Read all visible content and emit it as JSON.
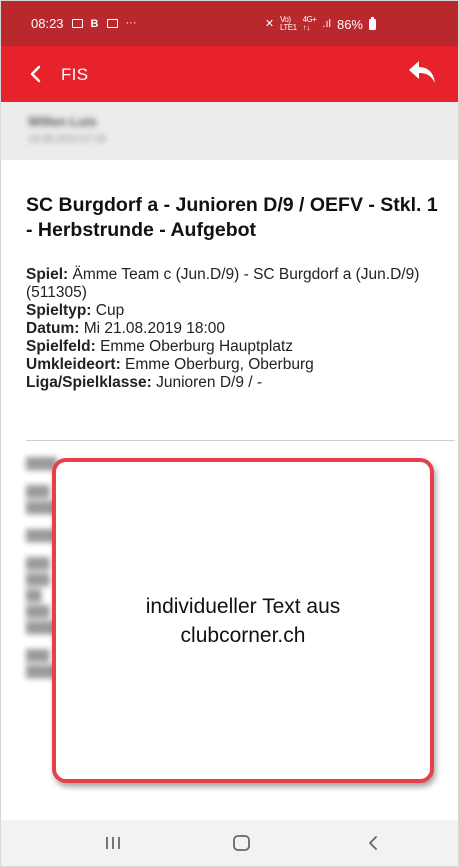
{
  "status_bar": {
    "time": "08:23",
    "notif_b": "B",
    "more": "···",
    "battery_percent": "86%"
  },
  "app_bar": {
    "title": "FIS"
  },
  "sender": {
    "name": "Willen Luis",
    "date": "19.08.2019 07:29"
  },
  "message": {
    "title": "SC Burgdorf a - Junioren D/9 / OEFV - Stkl. 1 - Herbstrunde - Aufgebot",
    "details": [
      {
        "label": "Spiel:",
        "value": " Ämme Team c (Jun.D/9) - SC Burgdorf a (Jun.D/9) (511305)"
      },
      {
        "label": "Spieltyp:",
        "value": " Cup"
      },
      {
        "label": "Datum:",
        "value": " Mi 21.08.2019 18:00"
      },
      {
        "label": "Spielfeld:",
        "value": " Emme Oberburg Hauptplatz"
      },
      {
        "label": "Umkleideort:",
        "value": " Emme Oberburg, Oberburg"
      },
      {
        "label": "Liga/Spielklasse:",
        "value": " Junioren D/9 / -"
      }
    ]
  },
  "overlay": {
    "text": "individueller Text aus clubcorner.ch"
  },
  "colors": {
    "status_bar": "#b8282d",
    "app_bar": "#e8222a",
    "callout_border": "#e8404a"
  },
  "icons": {
    "back": "arrow-left-icon",
    "reply": "reply-icon",
    "nav_recent": "recent-apps-icon",
    "nav_home": "home-icon",
    "nav_back": "nav-back-icon"
  }
}
